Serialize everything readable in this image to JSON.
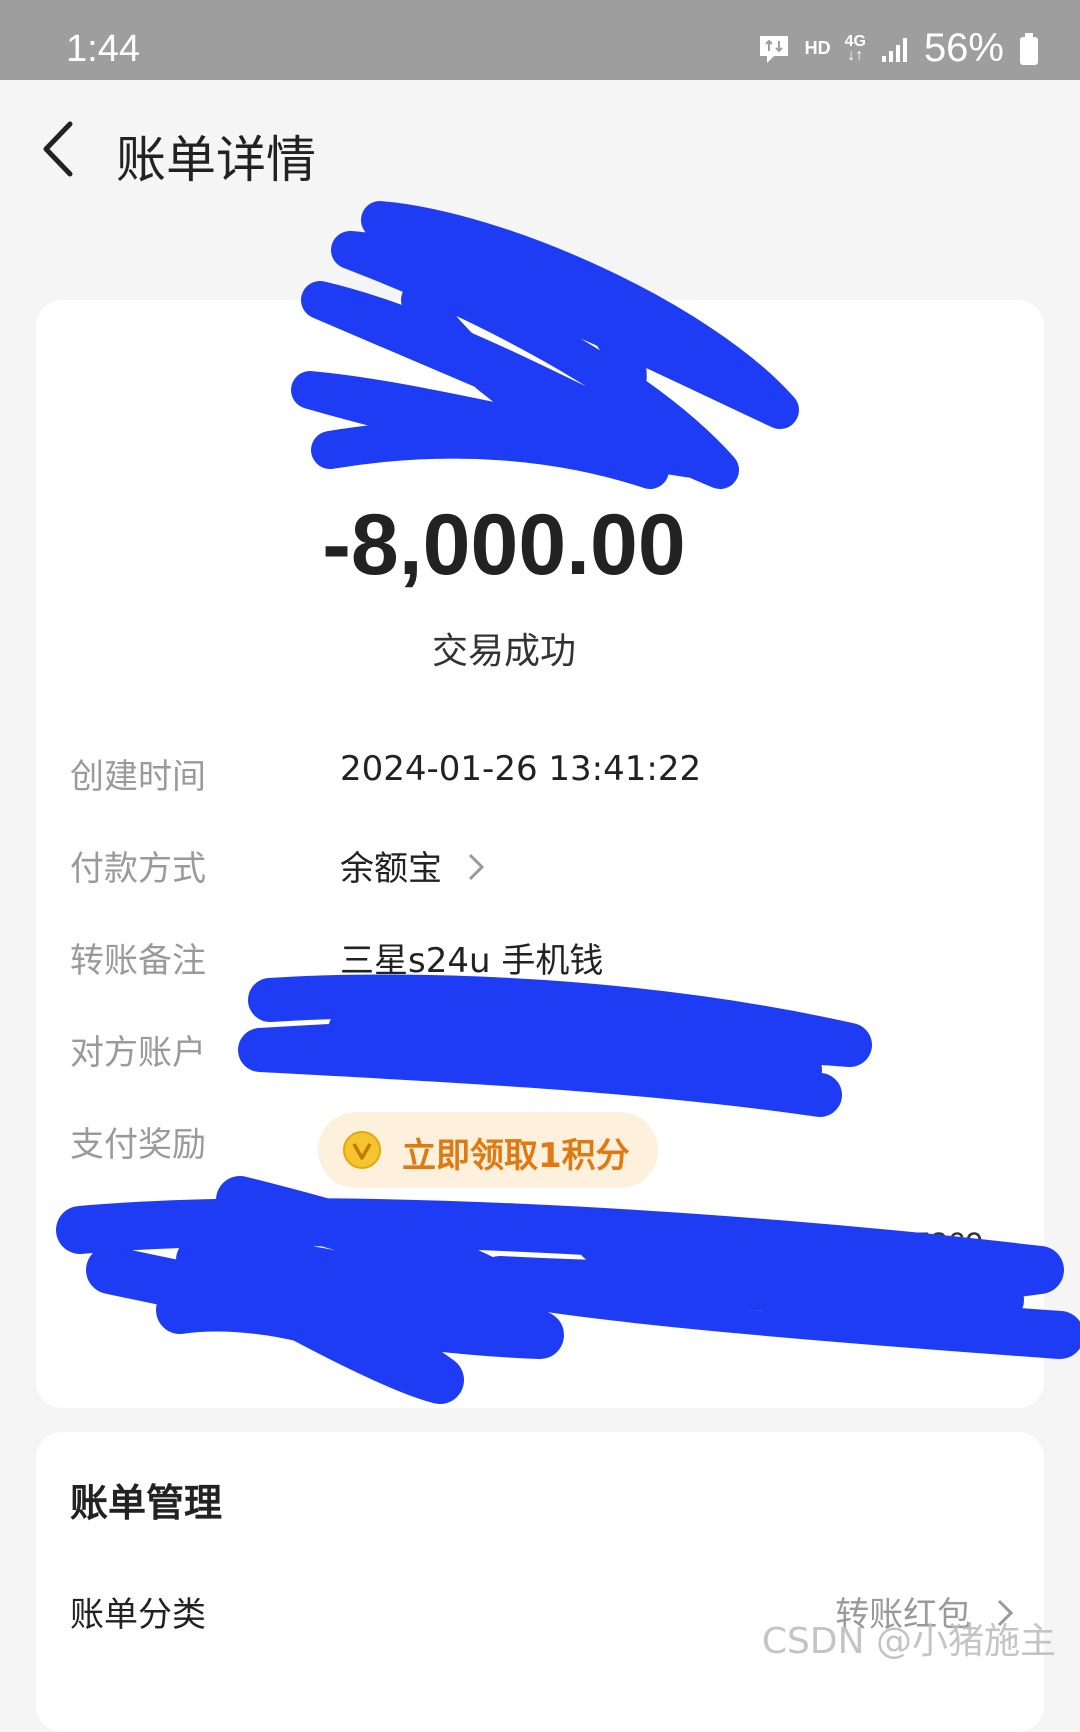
{
  "status_bar": {
    "time": "1:44",
    "hd": "HD",
    "network": "4G",
    "battery": "56%"
  },
  "header": {
    "title": "账单详情"
  },
  "bill": {
    "amount": "-8,000.00",
    "status": "交易成功",
    "rows": [
      {
        "label": "创建时间",
        "value": "2024-01-26 13:41:22"
      },
      {
        "label": "付款方式",
        "value": "余额宝"
      },
      {
        "label": "转账备注",
        "value": "三星s24u 手机钱"
      },
      {
        "label": "对方账户",
        "value": ""
      },
      {
        "label": "支付奖励",
        "value": "立即领取1积分"
      }
    ],
    "obscured_tail": "7269"
  },
  "management": {
    "title": "账单管理",
    "category_label": "账单分类",
    "category_value": "转账红包"
  },
  "watermark": "CSDN @小猪施主",
  "colors": {
    "redaction": "#1f3cf5",
    "reward_text": "#e07a10",
    "reward_bg": "#fdf0dc"
  }
}
